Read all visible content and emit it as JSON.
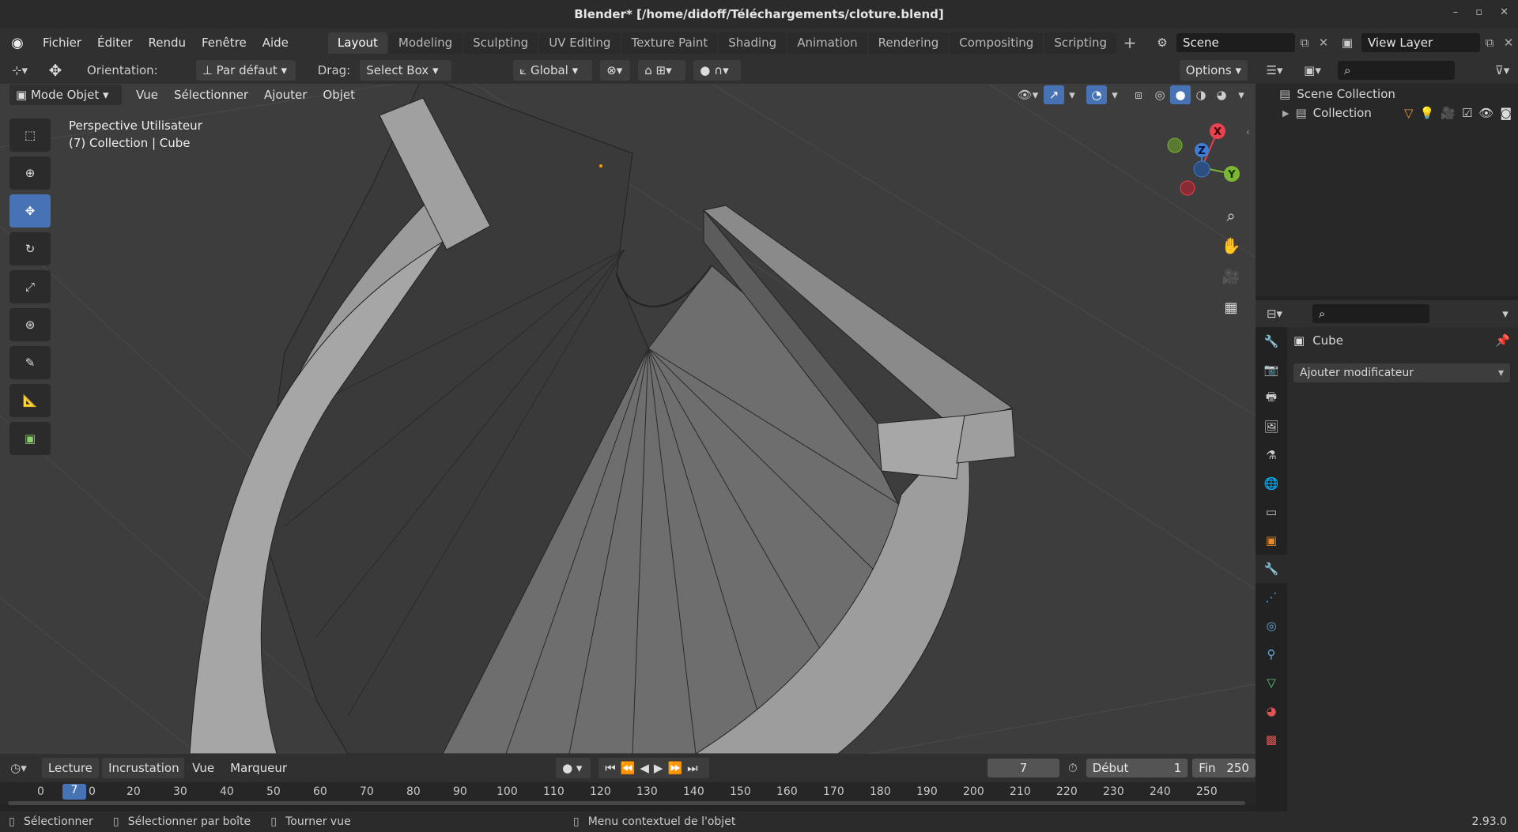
{
  "window": {
    "title": "Blender* [/home/didoff/Téléchargements/cloture.blend]"
  },
  "menu": [
    "Fichier",
    "Éditer",
    "Rendu",
    "Fenêtre",
    "Aide"
  ],
  "workspaces": [
    "Layout",
    "Modeling",
    "Sculpting",
    "UV Editing",
    "Texture Paint",
    "Shading",
    "Animation",
    "Rendering",
    "Compositing",
    "Scripting"
  ],
  "scene": {
    "name": "Scene",
    "view_layer": "View Layer"
  },
  "tool_header": {
    "orientation_label": "Orientation:",
    "orientation_value": "Par défaut",
    "drag_label": "Drag:",
    "drag_value": "Select Box",
    "transform_space": "Global",
    "options": "Options"
  },
  "view_header": {
    "mode": "Mode Objet",
    "menus": [
      "Vue",
      "Sélectionner",
      "Ajouter",
      "Objet"
    ]
  },
  "viewport": {
    "view_name": "Perspective Utilisateur",
    "context": "(7) Collection | Cube"
  },
  "gizmo": {
    "x": "X",
    "y": "Y",
    "z": "Z",
    "colors": {
      "x": "#e8414f",
      "y": "#7db534",
      "z": "#3a7ed5"
    }
  },
  "outliner": {
    "scene_collection": "Scene Collection",
    "collection": "Collection"
  },
  "properties": {
    "object": "Cube",
    "add_modifier": "Ajouter modificateur"
  },
  "timeline": {
    "menus": [
      "Lecture",
      "Incrustation",
      "Vue",
      "Marqueur"
    ],
    "current_frame": "7",
    "start_label": "Début",
    "start": "1",
    "end_label": "Fin",
    "end": "250",
    "ruler": [
      "0",
      "7",
      "0",
      "20",
      "30",
      "40",
      "50",
      "60",
      "70",
      "80",
      "90",
      "100",
      "110",
      "120",
      "130",
      "140",
      "150",
      "160",
      "170",
      "180",
      "190",
      "200",
      "210",
      "220",
      "230",
      "240",
      "250"
    ]
  },
  "status": {
    "select": "Sélectionner",
    "box_select": "Sélectionner par boîte",
    "rotate_view": "Tourner vue",
    "context_menu": "Menu contextuel de l'objet",
    "version": "2.93.0"
  },
  "colors": {
    "accent": "#4772b3",
    "modifier_tab": "#4b8bdc"
  }
}
